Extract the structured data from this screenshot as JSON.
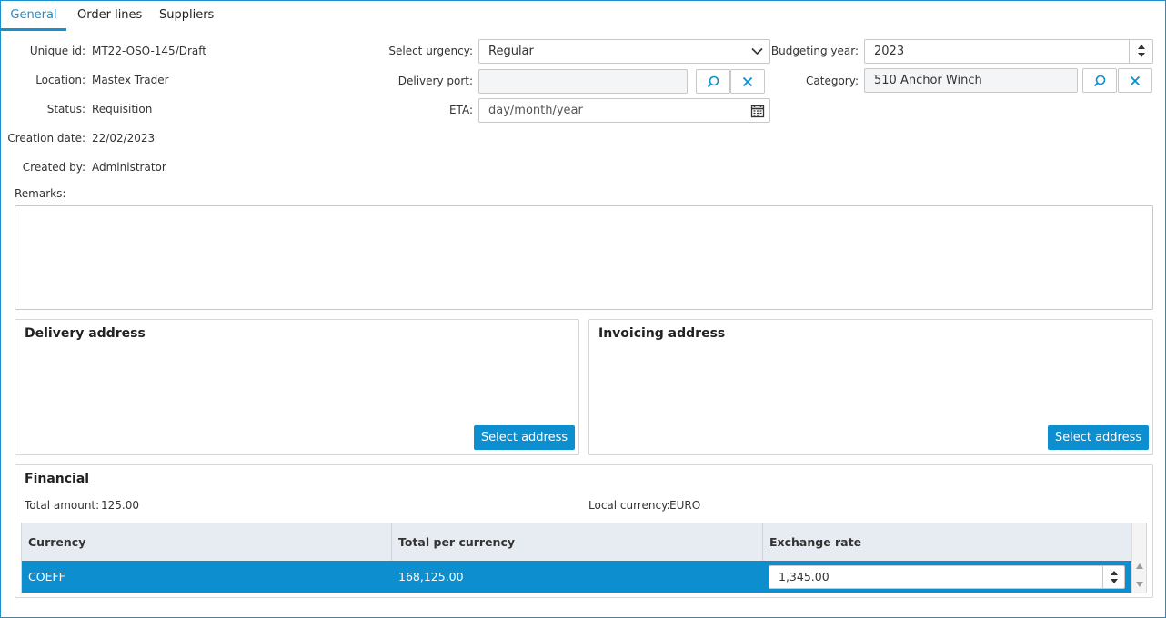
{
  "tabs": [
    "General",
    "Order lines",
    "Suppliers"
  ],
  "info": {
    "unique_id_label": "Unique id:",
    "unique_id": "MT22-OSO-145/Draft",
    "location_label": "Location:",
    "location": "Mastex Trader",
    "status_label": "Status:",
    "status": "Requisition",
    "creation_date_label": "Creation date:",
    "creation_date": "22/02/2023",
    "created_by_label": "Created by:",
    "created_by": "Administrator",
    "remarks_label": "Remarks:"
  },
  "form": {
    "urgency_label": "Select urgency:",
    "urgency_value": "Regular",
    "delivery_port_label": "Delivery port:",
    "delivery_port_value": "",
    "eta_label": "ETA:",
    "eta_placeholder": "day/month/year",
    "budgeting_year_label": "Budgeting year:",
    "budgeting_year_value": "2023",
    "category_label": "Category:",
    "category_value": "510 Anchor Winch"
  },
  "delivery": {
    "title": "Delivery address",
    "button": "Select address"
  },
  "invoicing": {
    "title": "Invoicing address",
    "button": "Select address"
  },
  "financial": {
    "title": "Financial",
    "total_amount_label": "Total amount:",
    "total_amount": "125.00",
    "local_currency_label": "Local currency:",
    "local_currency": "EURO",
    "columns": [
      "Currency",
      "Total per currency",
      "Exchange rate"
    ],
    "rows": [
      {
        "currency": "COEFF",
        "total": "168,125.00",
        "rate": "1,345.00"
      }
    ]
  },
  "colors": {
    "accent": "#0c8ecf",
    "border": "#1a8fc9"
  }
}
